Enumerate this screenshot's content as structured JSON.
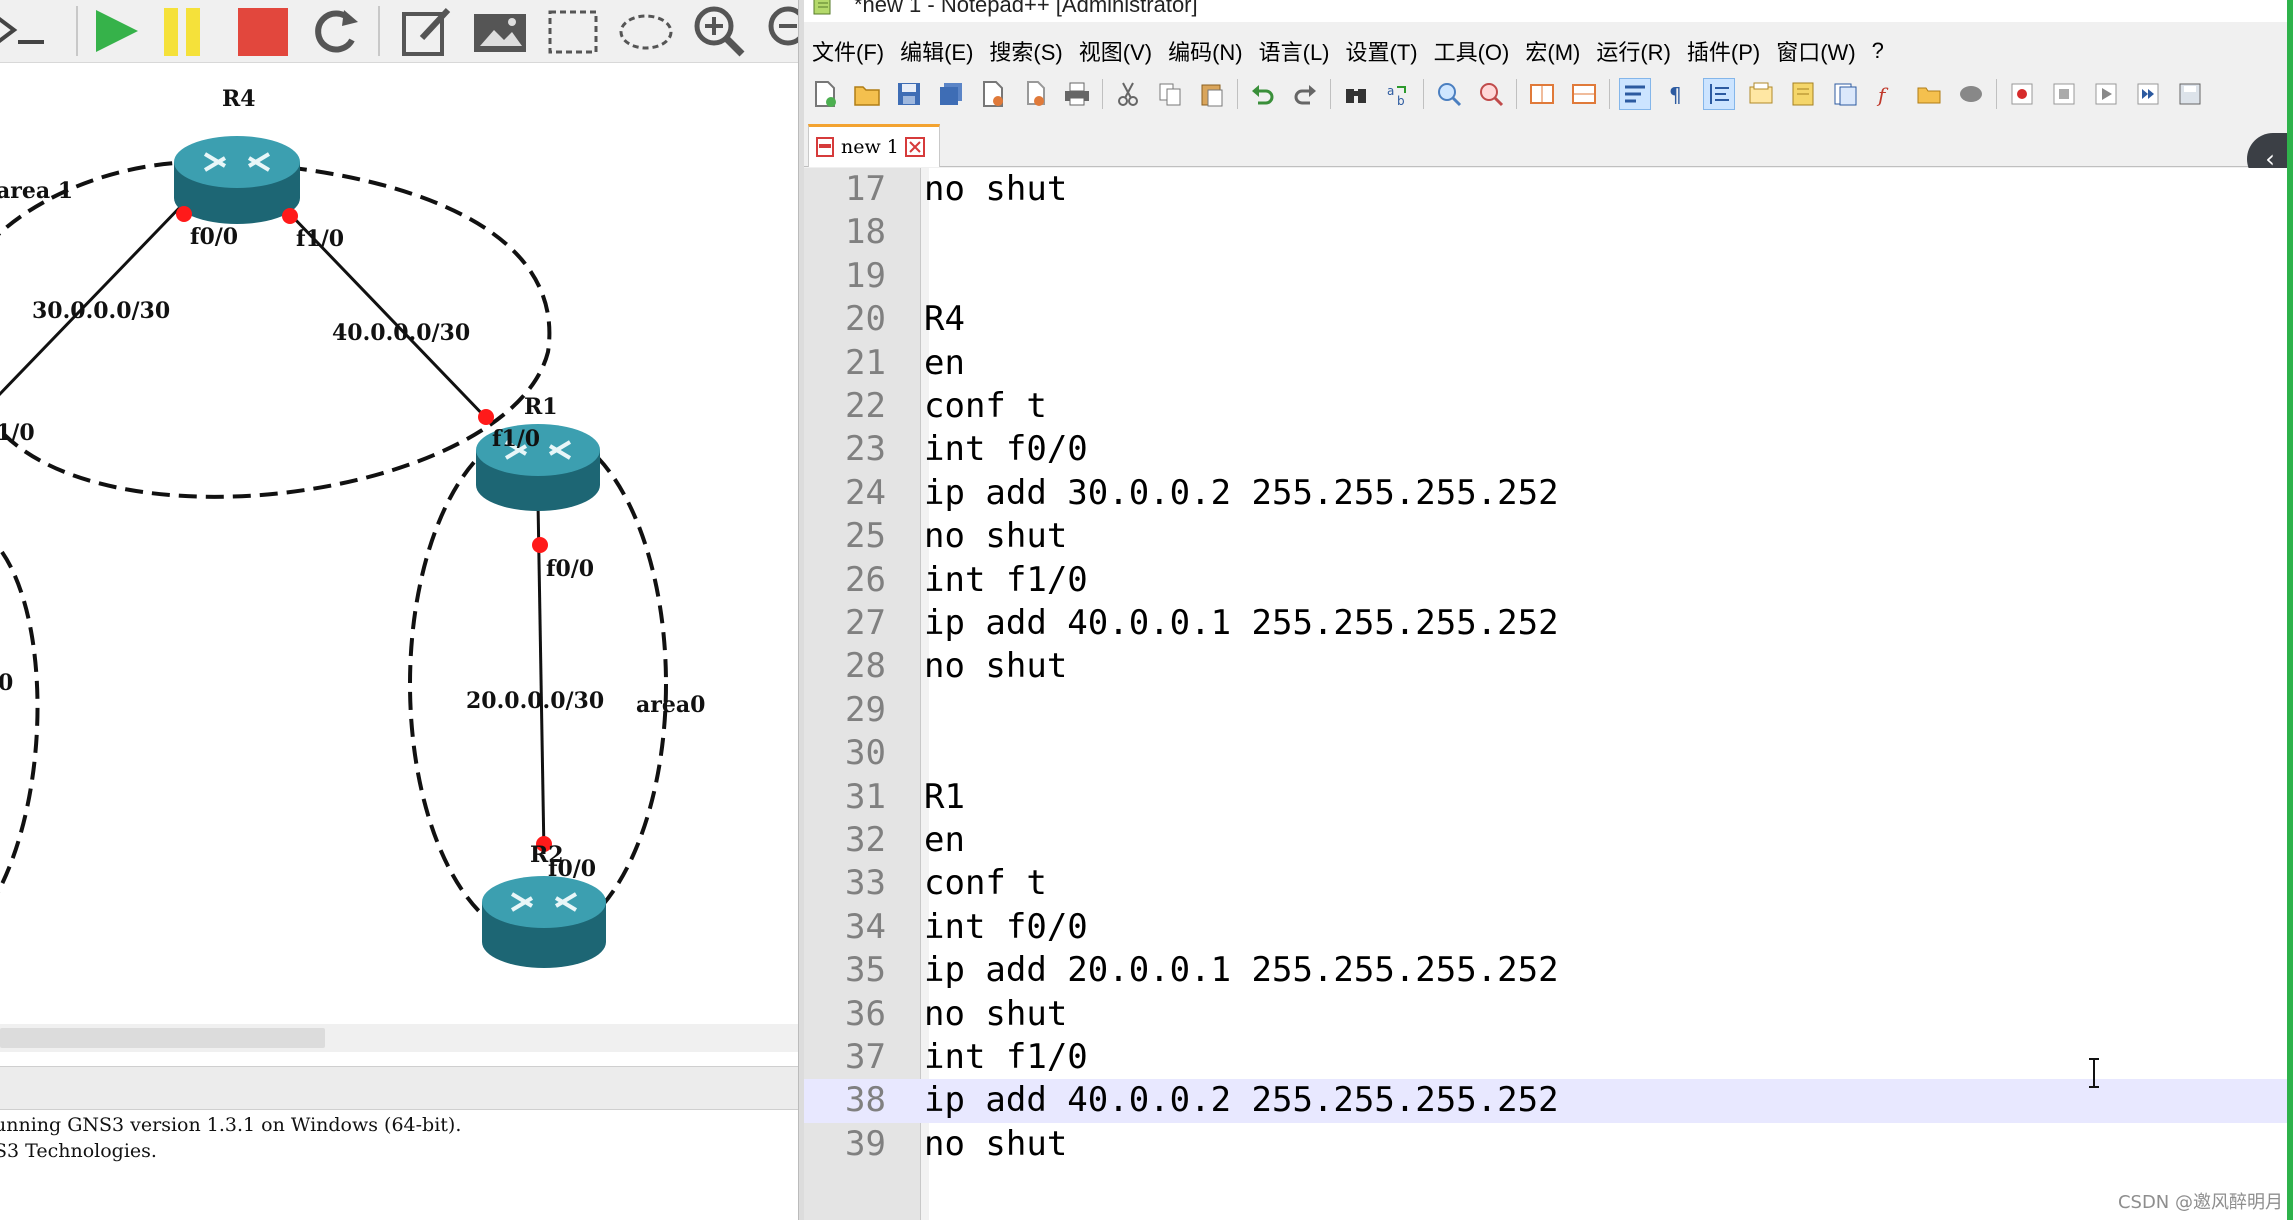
{
  "gns3": {
    "toolbar_icons": [
      "console-icon",
      "play-icon",
      "pause-icon",
      "stop-icon",
      "reload-icon",
      "note-icon",
      "picture-icon",
      "rectangle-icon",
      "ellipse-icon",
      "zoom-in-icon",
      "zoom-out-icon"
    ],
    "colors": {
      "play": "#36b24a",
      "pause": "#f5e13a",
      "stop": "#e2473d",
      "router_body": "#2d8a99",
      "port": "#ff1a1a"
    },
    "routers": [
      {
        "id": "r4",
        "label": "R4"
      },
      {
        "id": "r1",
        "label": "R1"
      },
      {
        "id": "r2",
        "label": "R2"
      }
    ],
    "links": [
      {
        "id": "r4-left",
        "subnet": "30.0.0.0/30",
        "port_near": "f0/0",
        "port_far": "1/0"
      },
      {
        "id": "r4-r1",
        "subnet": "40.0.0.0/30",
        "port_near": "f1/0",
        "port_far": "f1/0"
      },
      {
        "id": "r1-r2",
        "subnet": "20.0.0.0/30",
        "port_near": "f0/0",
        "port_far": "f0/0"
      }
    ],
    "areas": [
      {
        "id": "area-1",
        "label": "area 1"
      },
      {
        "id": "area-0",
        "label": "area0"
      }
    ],
    "edge_label_left": "0",
    "console_lines": [
      "unning GNS3 version 1.3.1 on Windows (64-bit).",
      "S3 Technologies."
    ]
  },
  "npp": {
    "title": "*new 1 - Notepad++ [Administrator]",
    "menu": [
      "文件(F)",
      "编辑(E)",
      "搜索(S)",
      "视图(V)",
      "编码(N)",
      "语言(L)",
      "设置(T)",
      "工具(O)",
      "宏(M)",
      "运行(R)",
      "插件(P)",
      "窗口(W)",
      "?"
    ],
    "tab": {
      "label": "new 1"
    },
    "collapse_label": "‹",
    "lines": [
      {
        "no": "17",
        "text": "no shut"
      },
      {
        "no": "18",
        "text": ""
      },
      {
        "no": "19",
        "text": ""
      },
      {
        "no": "20",
        "text": "R4"
      },
      {
        "no": "21",
        "text": "en"
      },
      {
        "no": "22",
        "text": "conf t"
      },
      {
        "no": "23",
        "text": "int f0/0"
      },
      {
        "no": "24",
        "text": "ip add 30.0.0.2 255.255.255.252"
      },
      {
        "no": "25",
        "text": "no shut"
      },
      {
        "no": "26",
        "text": "int f1/0"
      },
      {
        "no": "27",
        "text": "ip add 40.0.0.1 255.255.255.252"
      },
      {
        "no": "28",
        "text": "no shut"
      },
      {
        "no": "29",
        "text": ""
      },
      {
        "no": "30",
        "text": ""
      },
      {
        "no": "31",
        "text": "R1"
      },
      {
        "no": "32",
        "text": "en"
      },
      {
        "no": "33",
        "text": "conf t"
      },
      {
        "no": "34",
        "text": "int f0/0"
      },
      {
        "no": "35",
        "text": "ip add 20.0.0.1 255.255.255.252"
      },
      {
        "no": "36",
        "text": "no shut"
      },
      {
        "no": "37",
        "text": "int f1/0"
      },
      {
        "no": "38",
        "text": "ip add 40.0.0.2 255.255.255.252",
        "current": true
      },
      {
        "no": "39",
        "text": "no shut"
      }
    ],
    "colors": {
      "current_line": "#e8e8ff",
      "gutter": "#e4e4e4",
      "line_number": "#808080",
      "tab_accent": "#f3a330"
    }
  },
  "watermark": "CSDN @邀风醉明月"
}
